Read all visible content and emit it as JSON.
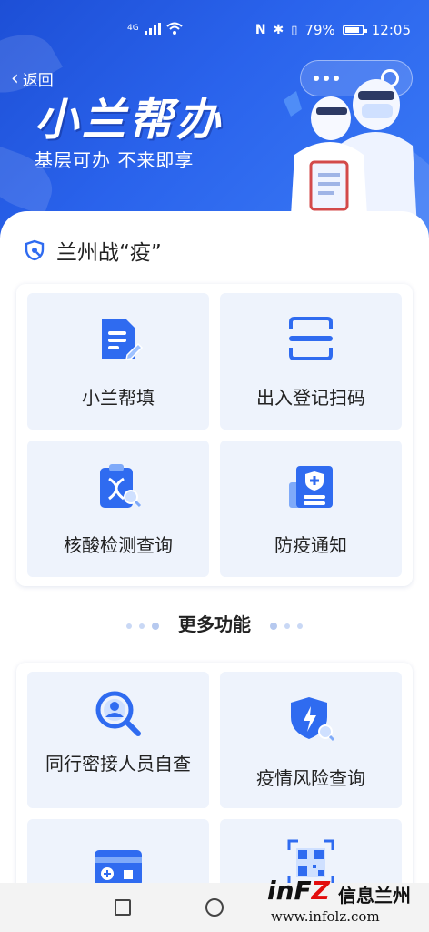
{
  "status_bar": {
    "battery": "79%",
    "time": "12:05",
    "network": "4G"
  },
  "header": {
    "back_label": "返回",
    "brand_title": "小兰帮办",
    "slogan": "基层可办 不来即享"
  },
  "section": {
    "title": "兰州战“疫”",
    "tiles": [
      {
        "label": "小兰帮填",
        "icon": "document-edit-icon"
      },
      {
        "label": "出入登记扫码",
        "icon": "scan-icon"
      },
      {
        "label": "核酸检测查询",
        "icon": "dna-clipboard-icon"
      },
      {
        "label": "防疫通知",
        "icon": "medical-notice-icon"
      }
    ]
  },
  "more": {
    "title": "更多功能",
    "tiles": [
      {
        "label": "同行密接人员自查",
        "icon": "person-search-icon"
      },
      {
        "label": "疫情风险查询",
        "icon": "shield-lightning-icon"
      },
      {
        "label": "",
        "icon": "health-card-icon"
      },
      {
        "label": "",
        "icon": "qr-code-icon"
      }
    ]
  },
  "watermark": {
    "logo_prefix": "inF",
    "logo_z": "Z",
    "name": "信息兰州",
    "url": "www.infolz.com"
  },
  "colors": {
    "primary": "#2a63ec",
    "tile_bg": "#eef3fc",
    "icon_blue": "#2f6bf0"
  }
}
